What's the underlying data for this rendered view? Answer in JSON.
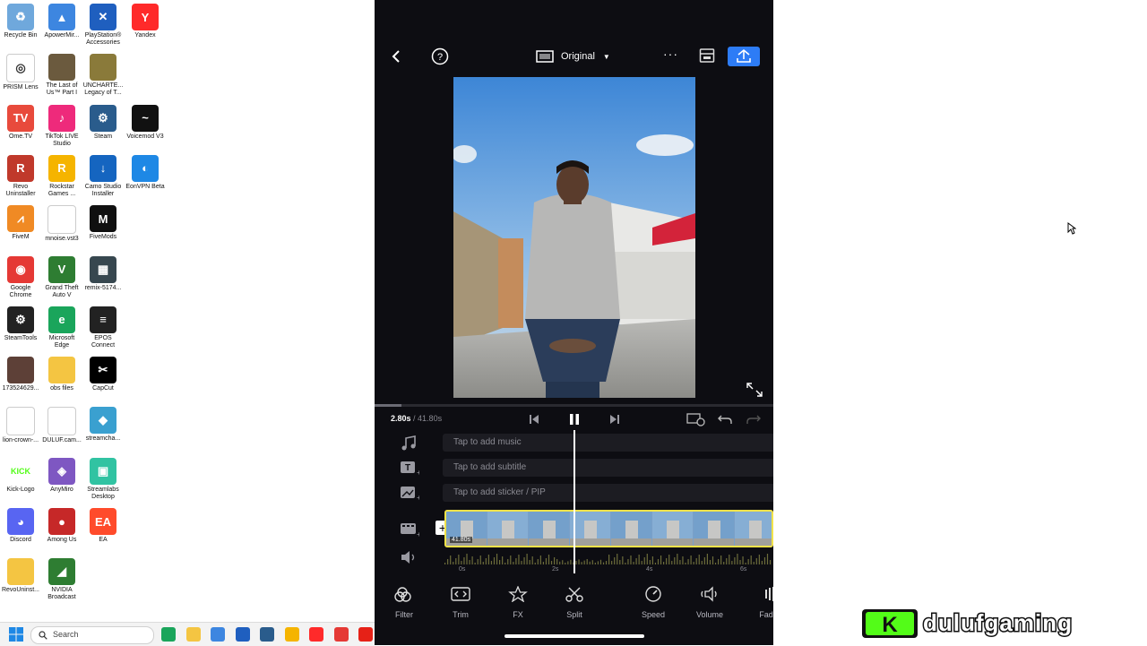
{
  "desktop": {
    "icons": [
      {
        "label": "Recycle Bin",
        "icon": "recycle-bin-icon",
        "color": "#6fa8dc",
        "glyph": "♻"
      },
      {
        "label": "ApowerMir...",
        "icon": "apowermirror-icon",
        "color": "#3d86e0",
        "glyph": "▲"
      },
      {
        "label": "PlayStation®\nAccessories",
        "icon": "playstation-icon",
        "color": "#1f5fbf",
        "glyph": "✕"
      },
      {
        "label": "Yandex",
        "icon": "yandex-icon",
        "color": "#ff2a2a",
        "glyph": "Y"
      },
      {
        "label": "PRISM Lens",
        "icon": "prism-lens-icon",
        "color": "#ffffff",
        "glyph": "◎"
      },
      {
        "label": "The Last of\nUs™ Part I",
        "icon": "the-last-of-us-icon",
        "color": "#6b5a3e",
        "glyph": ""
      },
      {
        "label": "UNCHARTE...\nLegacy of T...",
        "icon": "uncharted-icon",
        "color": "#8a7a3a",
        "glyph": ""
      },
      {
        "label": "",
        "icon": "blank-icon",
        "color": "#ffffff",
        "glyph": ""
      },
      {
        "label": "Ome.TV",
        "icon": "ometv-icon",
        "color": "#e84a3c",
        "glyph": "TV"
      },
      {
        "label": "TikTok LIVE\nStudio",
        "icon": "tiktok-live-icon",
        "color": "#ee2a7b",
        "glyph": "♪"
      },
      {
        "label": "Steam",
        "icon": "steam-icon",
        "color": "#2a5c8c",
        "glyph": "⚙"
      },
      {
        "label": "Voicemod V3",
        "icon": "voicemod-icon",
        "color": "#111111",
        "glyph": "~"
      },
      {
        "label": "Revo\nUninstaller",
        "icon": "revo-uninstaller-icon",
        "color": "#c0392b",
        "glyph": "R"
      },
      {
        "label": "Rockstar\nGames ...",
        "icon": "rockstar-icon",
        "color": "#f5b400",
        "glyph": "R"
      },
      {
        "label": "Camo Studio\nInstaller",
        "icon": "camo-studio-icon",
        "color": "#1565c0",
        "glyph": "↓"
      },
      {
        "label": "EonVPN Beta",
        "icon": "eonvpn-icon",
        "color": "#1e88e5",
        "glyph": "◐"
      },
      {
        "label": "FiveM",
        "icon": "fivem-icon",
        "color": "#f08a24",
        "glyph": "⩘"
      },
      {
        "label": "mnoise.vst3",
        "icon": "file-icon",
        "color": "#ffffff",
        "glyph": ""
      },
      {
        "label": "FiveMods",
        "icon": "fivemods-icon",
        "color": "#101010",
        "glyph": "M"
      },
      {
        "label": "",
        "icon": "blank-icon",
        "color": "#ffffff",
        "glyph": ""
      },
      {
        "label": "Google\nChrome",
        "icon": "chrome-icon",
        "color": "#e53935",
        "glyph": "◉"
      },
      {
        "label": "Grand Theft\nAuto V",
        "icon": "gta-icon",
        "color": "#2e7d32",
        "glyph": "V"
      },
      {
        "label": "remix-5174...",
        "icon": "video-file-icon",
        "color": "#37474f",
        "glyph": "▦"
      },
      {
        "label": "",
        "icon": "blank-icon",
        "color": "#ffffff",
        "glyph": ""
      },
      {
        "label": "SteamTools",
        "icon": "steamtools-icon",
        "color": "#222222",
        "glyph": "⚙"
      },
      {
        "label": "Microsoft\nEdge",
        "icon": "edge-icon",
        "color": "#1aa55b",
        "glyph": "e"
      },
      {
        "label": "EPOS\nConnect",
        "icon": "epos-icon",
        "color": "#222222",
        "glyph": "≡"
      },
      {
        "label": "",
        "icon": "blank-icon",
        "color": "#ffffff",
        "glyph": ""
      },
      {
        "label": "17352462​9...",
        "icon": "image-file-icon",
        "color": "#5d4037",
        "glyph": ""
      },
      {
        "label": "obs files",
        "icon": "folder-icon",
        "color": "#f4c542",
        "glyph": ""
      },
      {
        "label": "CapCut",
        "icon": "capcut-icon",
        "color": "#000000",
        "glyph": "✂"
      },
      {
        "label": "",
        "icon": "blank-icon",
        "color": "#ffffff",
        "glyph": ""
      },
      {
        "label": "lion-crown-...",
        "icon": "image-file-icon",
        "color": "#ffffff",
        "glyph": ""
      },
      {
        "label": "DULUF.cam...",
        "icon": "file-icon",
        "color": "#ffffff",
        "glyph": ""
      },
      {
        "label": "streamcha...",
        "icon": "streamchamp-icon",
        "color": "#3aa0d0",
        "glyph": "◆"
      },
      {
        "label": "",
        "icon": "blank-icon",
        "color": "#ffffff",
        "glyph": ""
      },
      {
        "label": "Kick-Logo",
        "icon": "kick-icon",
        "color": "#ffffff",
        "glyph": "KICK"
      },
      {
        "label": "AnyMiro",
        "icon": "anymiro-icon",
        "color": "#7e57c2",
        "glyph": "◈"
      },
      {
        "label": "Streamlabs\nDesktop",
        "icon": "streamlabs-icon",
        "color": "#31c3a2",
        "glyph": "▣"
      },
      {
        "label": "",
        "icon": "blank-icon",
        "color": "#ffffff",
        "glyph": ""
      },
      {
        "label": "Discord",
        "icon": "discord-icon",
        "color": "#5865f2",
        "glyph": "◕"
      },
      {
        "label": "Among Us",
        "icon": "among-us-icon",
        "color": "#c62828",
        "glyph": "●"
      },
      {
        "label": "EA",
        "icon": "ea-icon",
        "color": "#ff4b2b",
        "glyph": "EA"
      },
      {
        "label": "",
        "icon": "blank-icon",
        "color": "#ffffff",
        "glyph": ""
      },
      {
        "label": "RevoUninst...",
        "icon": "folder-icon",
        "color": "#f4c542",
        "glyph": ""
      },
      {
        "label": "NVIDIA\nBroadcast",
        "icon": "nvidia-broadcast-icon",
        "color": "#2e7d32",
        "glyph": "◢"
      }
    ]
  },
  "taskbar": {
    "search_placeholder": "Search",
    "apps": [
      {
        "icon": "edge-icon",
        "color": "#1aa55b"
      },
      {
        "icon": "file-explorer-icon",
        "color": "#f4c542"
      },
      {
        "icon": "store-icon",
        "color": "#3d86e0"
      },
      {
        "icon": "app-icon",
        "color": "#1f5fbf"
      },
      {
        "icon": "steam-icon",
        "color": "#2a5c8c"
      },
      {
        "icon": "rockstar-icon",
        "color": "#f5b400"
      },
      {
        "icon": "yandex-icon",
        "color": "#ff2a2a"
      },
      {
        "icon": "chrome-icon",
        "color": "#e53935"
      },
      {
        "icon": "youtube-icon",
        "color": "#e62117"
      }
    ]
  },
  "editor": {
    "aspect_label": "Original",
    "time_current": "2.80s",
    "time_total": "/ 41.80s",
    "tracks": {
      "music": "Tap to add music",
      "subtitle": "Tap to add subtitle",
      "sticker": "Tap to add sticker / PIP"
    },
    "clip_duration": "41.80s",
    "ruler": [
      "0s",
      "2s",
      "4s",
      "6s"
    ],
    "tools": [
      {
        "label": "Filter",
        "icon": "filter-icon"
      },
      {
        "label": "Trim",
        "icon": "trim-icon"
      },
      {
        "label": "FX",
        "icon": "fx-icon"
      },
      {
        "label": "Split",
        "icon": "split-icon"
      },
      {
        "label": "Speed",
        "icon": "speed-icon"
      },
      {
        "label": "Volume",
        "icon": "volume-icon"
      },
      {
        "label": "Fad",
        "icon": "fade-icon"
      }
    ],
    "playhead_fraction": 0.067,
    "accent_color": "#2d7cf6",
    "clip_border_color": "#f2e34a"
  },
  "watermark": {
    "text": "dulufgaming",
    "logo_letter": "K"
  }
}
